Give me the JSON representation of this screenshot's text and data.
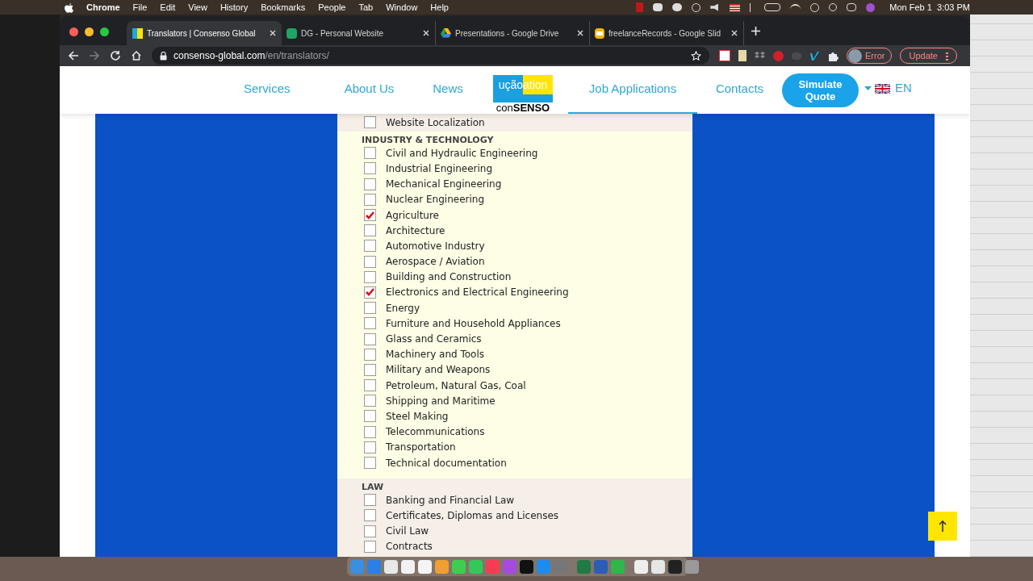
{
  "menu_bar": {
    "app": "Chrome",
    "items": [
      "File",
      "Edit",
      "View",
      "History",
      "Bookmarks",
      "People",
      "Tab",
      "Window",
      "Help"
    ],
    "clock": "Mon Feb 1  3:03 PM"
  },
  "tabs": [
    {
      "title": "Translators | Consenso Global",
      "selected": true,
      "kind": "site"
    },
    {
      "title": "DG - Personal Website",
      "selected": false,
      "kind": "sheet"
    },
    {
      "title": "Presentations - Google Drive",
      "selected": false,
      "kind": "drive"
    },
    {
      "title": "freelanceRecords - Google Slid",
      "selected": false,
      "kind": "slides"
    }
  ],
  "address": {
    "host": "consenso-global.com",
    "path": "/en/translators/"
  },
  "profile_button": "Error",
  "update_button": "Update",
  "nav": {
    "left": [
      {
        "label": "Services",
        "selected": false
      },
      {
        "label": "About Us",
        "selected": false
      },
      {
        "label": "News",
        "selected": false
      }
    ],
    "logo": {
      "top_left": "ução",
      "top_right": "ation",
      "bottom": "con**SENSO**"
    },
    "right": [
      {
        "label": "Job Applications",
        "selected": true
      },
      {
        "label": "Contacts",
        "selected": false
      }
    ],
    "quote_button": "Simulate Quote",
    "language": "EN"
  },
  "sections": [
    {
      "items": [
        {
          "label": "Website Localization",
          "checked": false
        }
      ]
    },
    {
      "heading": "INDUSTRY & TECHNOLOGY",
      "items": [
        {
          "label": "Civil and Hydraulic Engineering",
          "checked": false
        },
        {
          "label": "Industrial Engineering",
          "checked": false
        },
        {
          "label": "Mechanical Engineering",
          "checked": false
        },
        {
          "label": "Nuclear Engineering",
          "checked": false
        },
        {
          "label": "Agriculture",
          "checked": true
        },
        {
          "label": "Architecture",
          "checked": false
        },
        {
          "label": "Automotive Industry",
          "checked": false
        },
        {
          "label": "Aerospace / Aviation",
          "checked": false
        },
        {
          "label": "Building and Construction",
          "checked": false
        },
        {
          "label": "Electronics and Electrical Engineering",
          "checked": true
        },
        {
          "label": "Energy",
          "checked": false
        },
        {
          "label": "Furniture and Household Appliances",
          "checked": false
        },
        {
          "label": "Glass and Ceramics",
          "checked": false
        },
        {
          "label": "Machinery and Tools",
          "checked": false
        },
        {
          "label": "Military and Weapons",
          "checked": false
        },
        {
          "label": "Petroleum, Natural Gas, Coal",
          "checked": false
        },
        {
          "label": "Shipping and Maritime",
          "checked": false
        },
        {
          "label": "Steel Making",
          "checked": false
        },
        {
          "label": "Telecommunications",
          "checked": false
        },
        {
          "label": "Transportation",
          "checked": false
        },
        {
          "label": "Technical documentation",
          "checked": false
        }
      ]
    },
    {
      "heading": "LAW",
      "items": [
        {
          "label": "Banking and Financial Law",
          "checked": false
        },
        {
          "label": "Certificates, Diplomas and Licenses",
          "checked": false
        },
        {
          "label": "Civil Law",
          "checked": false
        },
        {
          "label": "Contracts",
          "checked": false
        }
      ]
    }
  ]
}
